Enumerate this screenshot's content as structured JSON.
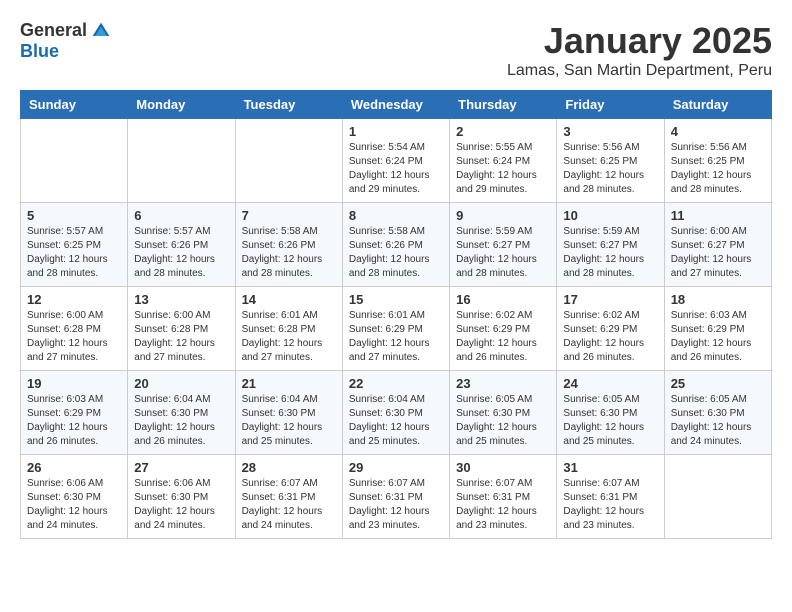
{
  "logo": {
    "general": "General",
    "blue": "Blue"
  },
  "title": "January 2025",
  "subtitle": "Lamas, San Martin Department, Peru",
  "days_header": [
    "Sunday",
    "Monday",
    "Tuesday",
    "Wednesday",
    "Thursday",
    "Friday",
    "Saturday"
  ],
  "weeks": [
    [
      {
        "day": "",
        "info": ""
      },
      {
        "day": "",
        "info": ""
      },
      {
        "day": "",
        "info": ""
      },
      {
        "day": "1",
        "info": "Sunrise: 5:54 AM\nSunset: 6:24 PM\nDaylight: 12 hours\nand 29 minutes."
      },
      {
        "day": "2",
        "info": "Sunrise: 5:55 AM\nSunset: 6:24 PM\nDaylight: 12 hours\nand 29 minutes."
      },
      {
        "day": "3",
        "info": "Sunrise: 5:56 AM\nSunset: 6:25 PM\nDaylight: 12 hours\nand 28 minutes."
      },
      {
        "day": "4",
        "info": "Sunrise: 5:56 AM\nSunset: 6:25 PM\nDaylight: 12 hours\nand 28 minutes."
      }
    ],
    [
      {
        "day": "5",
        "info": "Sunrise: 5:57 AM\nSunset: 6:25 PM\nDaylight: 12 hours\nand 28 minutes."
      },
      {
        "day": "6",
        "info": "Sunrise: 5:57 AM\nSunset: 6:26 PM\nDaylight: 12 hours\nand 28 minutes."
      },
      {
        "day": "7",
        "info": "Sunrise: 5:58 AM\nSunset: 6:26 PM\nDaylight: 12 hours\nand 28 minutes."
      },
      {
        "day": "8",
        "info": "Sunrise: 5:58 AM\nSunset: 6:26 PM\nDaylight: 12 hours\nand 28 minutes."
      },
      {
        "day": "9",
        "info": "Sunrise: 5:59 AM\nSunset: 6:27 PM\nDaylight: 12 hours\nand 28 minutes."
      },
      {
        "day": "10",
        "info": "Sunrise: 5:59 AM\nSunset: 6:27 PM\nDaylight: 12 hours\nand 28 minutes."
      },
      {
        "day": "11",
        "info": "Sunrise: 6:00 AM\nSunset: 6:27 PM\nDaylight: 12 hours\nand 27 minutes."
      }
    ],
    [
      {
        "day": "12",
        "info": "Sunrise: 6:00 AM\nSunset: 6:28 PM\nDaylight: 12 hours\nand 27 minutes."
      },
      {
        "day": "13",
        "info": "Sunrise: 6:00 AM\nSunset: 6:28 PM\nDaylight: 12 hours\nand 27 minutes."
      },
      {
        "day": "14",
        "info": "Sunrise: 6:01 AM\nSunset: 6:28 PM\nDaylight: 12 hours\nand 27 minutes."
      },
      {
        "day": "15",
        "info": "Sunrise: 6:01 AM\nSunset: 6:29 PM\nDaylight: 12 hours\nand 27 minutes."
      },
      {
        "day": "16",
        "info": "Sunrise: 6:02 AM\nSunset: 6:29 PM\nDaylight: 12 hours\nand 26 minutes."
      },
      {
        "day": "17",
        "info": "Sunrise: 6:02 AM\nSunset: 6:29 PM\nDaylight: 12 hours\nand 26 minutes."
      },
      {
        "day": "18",
        "info": "Sunrise: 6:03 AM\nSunset: 6:29 PM\nDaylight: 12 hours\nand 26 minutes."
      }
    ],
    [
      {
        "day": "19",
        "info": "Sunrise: 6:03 AM\nSunset: 6:29 PM\nDaylight: 12 hours\nand 26 minutes."
      },
      {
        "day": "20",
        "info": "Sunrise: 6:04 AM\nSunset: 6:30 PM\nDaylight: 12 hours\nand 26 minutes."
      },
      {
        "day": "21",
        "info": "Sunrise: 6:04 AM\nSunset: 6:30 PM\nDaylight: 12 hours\nand 25 minutes."
      },
      {
        "day": "22",
        "info": "Sunrise: 6:04 AM\nSunset: 6:30 PM\nDaylight: 12 hours\nand 25 minutes."
      },
      {
        "day": "23",
        "info": "Sunrise: 6:05 AM\nSunset: 6:30 PM\nDaylight: 12 hours\nand 25 minutes."
      },
      {
        "day": "24",
        "info": "Sunrise: 6:05 AM\nSunset: 6:30 PM\nDaylight: 12 hours\nand 25 minutes."
      },
      {
        "day": "25",
        "info": "Sunrise: 6:05 AM\nSunset: 6:30 PM\nDaylight: 12 hours\nand 24 minutes."
      }
    ],
    [
      {
        "day": "26",
        "info": "Sunrise: 6:06 AM\nSunset: 6:30 PM\nDaylight: 12 hours\nand 24 minutes."
      },
      {
        "day": "27",
        "info": "Sunrise: 6:06 AM\nSunset: 6:30 PM\nDaylight: 12 hours\nand 24 minutes."
      },
      {
        "day": "28",
        "info": "Sunrise: 6:07 AM\nSunset: 6:31 PM\nDaylight: 12 hours\nand 24 minutes."
      },
      {
        "day": "29",
        "info": "Sunrise: 6:07 AM\nSunset: 6:31 PM\nDaylight: 12 hours\nand 23 minutes."
      },
      {
        "day": "30",
        "info": "Sunrise: 6:07 AM\nSunset: 6:31 PM\nDaylight: 12 hours\nand 23 minutes."
      },
      {
        "day": "31",
        "info": "Sunrise: 6:07 AM\nSunset: 6:31 PM\nDaylight: 12 hours\nand 23 minutes."
      },
      {
        "day": "",
        "info": ""
      }
    ]
  ]
}
